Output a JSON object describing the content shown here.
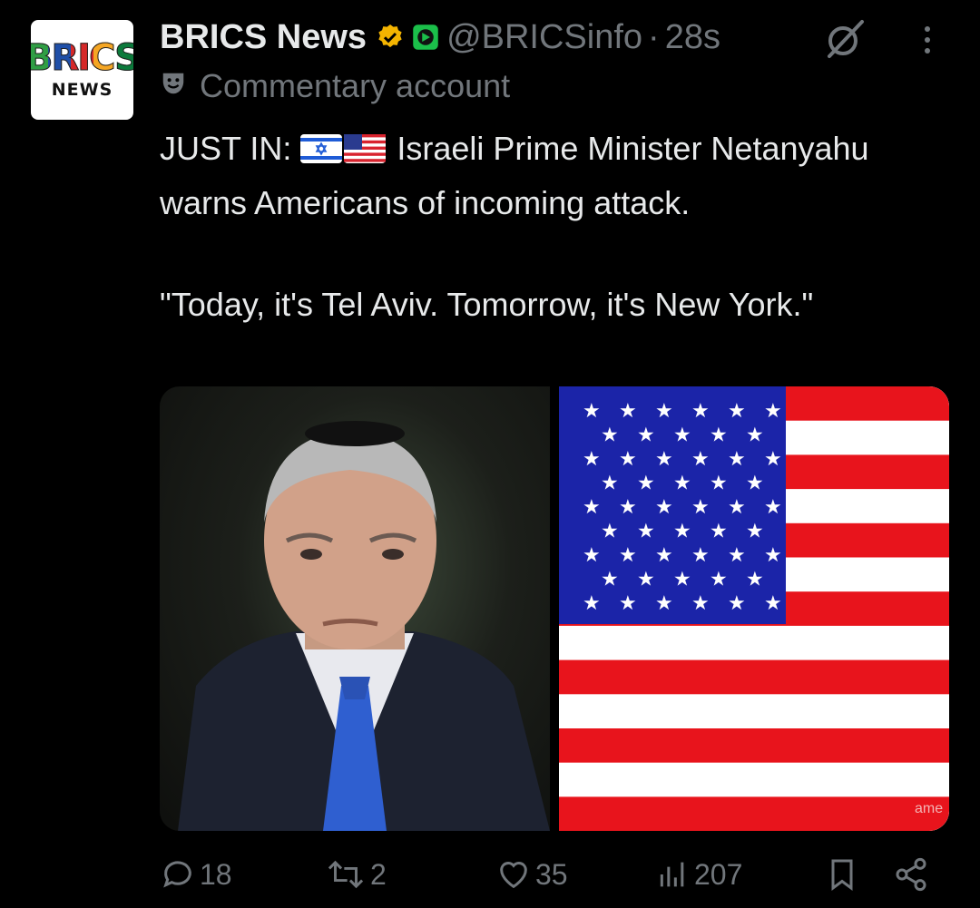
{
  "author": {
    "logo_top": "BRICS",
    "logo_bottom": "NEWS",
    "name": "BRICS News",
    "handle": "@BRICSinfo",
    "separator": "·",
    "time": "28s",
    "label": "Commentary account"
  },
  "post": {
    "prefix": "JUST IN: ",
    "body": "Israeli Prime Minister Netanyahu warns Americans of incoming attack.\n\n\"Today, it's Tel Aviv. Tomorrow, it's New York.\"",
    "flags": [
      "israel-flag",
      "us-flag"
    ]
  },
  "media": {
    "left": "portrait-photo",
    "right": "us-flag-image",
    "watermark": "ame"
  },
  "actions": {
    "replies": "18",
    "reposts": "2",
    "likes": "35",
    "views": "207"
  },
  "colors": {
    "background": "#000000",
    "text": "#e7e9ea",
    "muted": "#71767b",
    "verified": "#f4b400",
    "flag_red": "#e8141c",
    "flag_blue": "#1b24a8"
  }
}
